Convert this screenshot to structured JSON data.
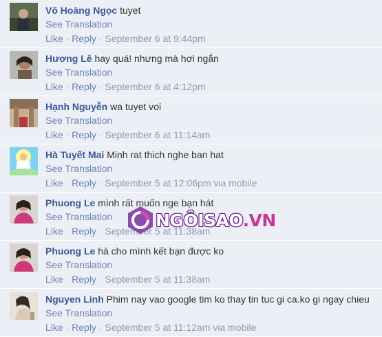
{
  "comments": [
    {
      "author": "Võ Hoàng Ngọc",
      "message": "tuyet",
      "see_translation": "See Translation",
      "like": "Like",
      "reply": "Reply",
      "separator": "·",
      "timestamp": "September 6 at 9:44pm",
      "via": ""
    },
    {
      "author": "Hương Lê",
      "message": "hay quá! nhưng mà hơi ngắn",
      "see_translation": "See Translation",
      "like": "Like",
      "reply": "Reply",
      "separator": "·",
      "timestamp": "September 6 at 4:12pm",
      "via": ""
    },
    {
      "author": "Hạnh Nguyễn",
      "message": "wa tuyet voi",
      "see_translation": "See Translation",
      "like": "Like",
      "reply": "Reply",
      "separator": "·",
      "timestamp": "September 6 at 11:14am",
      "via": ""
    },
    {
      "author": "Hà Tuyết Mai",
      "message": "Minh rat thich nghe ban hat",
      "see_translation": "See Translation",
      "like": "Like",
      "reply": "Reply",
      "separator": "·",
      "timestamp": "September 5 at 12:06pm",
      "via": "via mobile"
    },
    {
      "author": "Phuong Le",
      "message": "mình rất muốn nge bạn hát",
      "see_translation": "See Translation",
      "like": "Like",
      "reply": "Reply",
      "separator": "·",
      "timestamp": "September 5 at 11:38am",
      "via": ""
    },
    {
      "author": "Phuong Le",
      "message": "hà cho mình kết bạn được ko",
      "see_translation": "See Translation",
      "like": "Like",
      "reply": "Reply",
      "separator": "·",
      "timestamp": "September 5 at 11:38am",
      "via": ""
    },
    {
      "author": "Nguyen Linh",
      "message": "Phim nay vao google tim ko thay tin tuc gi ca.ko gi ngay chieu",
      "see_translation": "See Translation",
      "like": "Like",
      "reply": "Reply",
      "separator": "·",
      "timestamp": "September 5 at 11:12am",
      "via": "via mobile"
    }
  ],
  "watermark": {
    "text_main": "NGÔISAO",
    "text_suffix": ".VN"
  },
  "colors": {
    "background": "#eceff5",
    "author": "#3b5998",
    "link": "#6d84b4",
    "meta": "#8f9bb3",
    "watermark": "#6a1d8e"
  }
}
